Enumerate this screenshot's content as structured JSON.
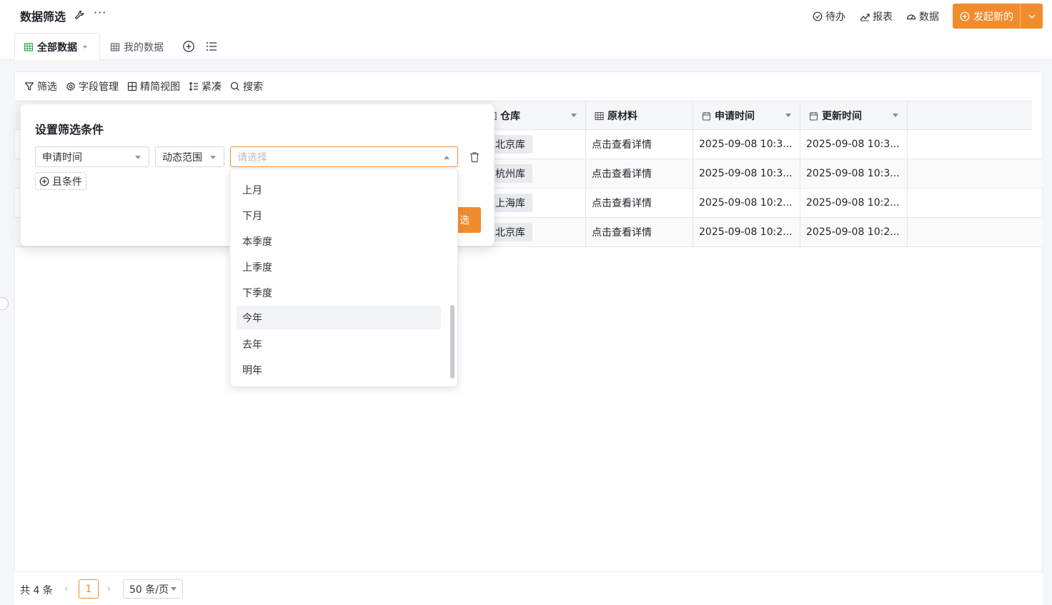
{
  "app": {
    "title": "数据筛选"
  },
  "header": {
    "links": [
      {
        "label": "待办",
        "icon": "check-circle-icon"
      },
      {
        "label": "报表",
        "icon": "trend-chart-icon"
      },
      {
        "label": "数据",
        "icon": "dashboard-icon"
      }
    ],
    "new_button": "发起新的",
    "accent": "#f08c2e"
  },
  "tabs": [
    {
      "label": "全部数据",
      "active": true
    },
    {
      "label": "我的数据",
      "active": false
    }
  ],
  "toolbar": {
    "filter": "筛选",
    "fields": "字段管理",
    "compact_view": "精简视图",
    "density": "紧凑",
    "search": "搜索"
  },
  "table": {
    "columns": [
      "仓库",
      "原材料",
      "申请时间",
      "更新时间"
    ],
    "rows": [
      {
        "warehouse": "北京库",
        "material": "点击查看详情",
        "applied": "2025-09-08 10:3...",
        "updated": "2025-09-08 10:3..."
      },
      {
        "warehouse": "杭州库",
        "material": "点击查看详情",
        "applied": "2025-09-08 10:3...",
        "updated": "2025-09-08 10:3..."
      },
      {
        "warehouse": "上海库",
        "material": "点击查看详情",
        "applied": "2025-09-08 10:2...",
        "updated": "2025-09-08 10:2..."
      },
      {
        "warehouse": "北京库",
        "material": "点击查看详情",
        "applied": "2025-09-08 10:2...",
        "updated": "2025-09-08 10:2..."
      }
    ]
  },
  "filter_popover": {
    "title": "设置筛选条件",
    "field": "申请时间",
    "operator": "动态范围",
    "value_placeholder": "请选择",
    "and_condition": "且条件",
    "apply_label_partial": "选"
  },
  "dropdown": {
    "options": [
      "上月",
      "下月",
      "本季度",
      "上季度",
      "下季度",
      "今年",
      "去年",
      "明年"
    ],
    "hovered": "今年"
  },
  "pagination": {
    "total": "共 4 条",
    "current_page": "1",
    "page_size": "50 条/页"
  }
}
